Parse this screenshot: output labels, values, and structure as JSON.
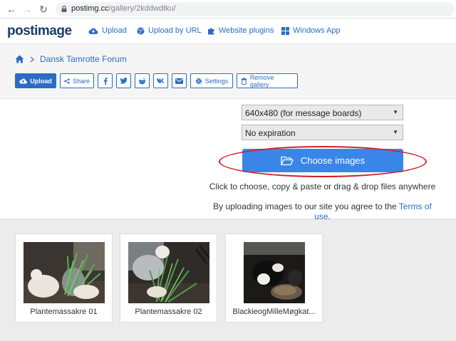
{
  "browser": {
    "url_host": "postimg.cc",
    "url_path": "/gallery/2kddwdtku/"
  },
  "site": {
    "logo_post": "post",
    "logo_image": "image",
    "nav": [
      {
        "label": "Upload",
        "icon": "cloud-upload-icon"
      },
      {
        "label": "Upload by URL",
        "icon": "globe-icon"
      },
      {
        "label": "Website plugins",
        "icon": "puzzle-icon"
      },
      {
        "label": "Windows App",
        "icon": "windows-icon"
      }
    ]
  },
  "gallery": {
    "breadcrumb_title": "Dansk Tamrotte Forum",
    "toolbar": {
      "upload": "Upload",
      "share": "Share",
      "settings": "Settings",
      "remove": "Remove gallery"
    }
  },
  "upload": {
    "size_option": "640x480 (for message boards)",
    "expiration_option": "No expiration",
    "choose_label": "Choose images",
    "hint": "Click to choose, copy & paste or drag & drop files anywhere",
    "terms_prefix": "By uploading images to our site you agree to the ",
    "terms_link": "Terms of use",
    "terms_suffix": "."
  },
  "thumbnails": [
    {
      "caption": "Plantemassakre 01"
    },
    {
      "caption": "Plantemassakre 02"
    },
    {
      "caption": "BlackieogMilleMøgkat..."
    }
  ],
  "colors": {
    "accent": "#2b6cc4",
    "button": "#3a86e8",
    "highlight": "#d21f2b"
  }
}
